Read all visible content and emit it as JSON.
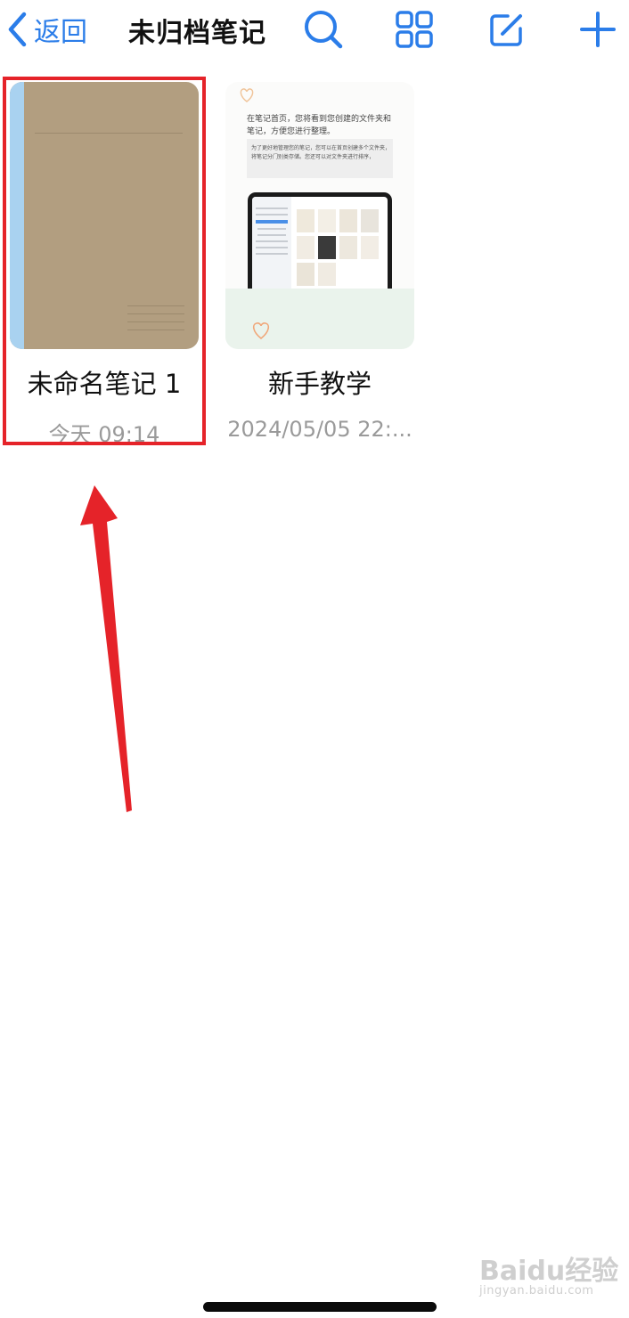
{
  "navbar": {
    "back_label": "返回",
    "title": "未归档笔记",
    "icons": [
      "search-icon",
      "grid-view-icon",
      "compose-icon",
      "add-icon"
    ],
    "accent": "#2b7de9"
  },
  "notes": [
    {
      "name": "未命名笔记 1",
      "date": "今天 09:14",
      "cover_color": "#b29e80",
      "spine_color": "#a9d2f0"
    },
    {
      "name": "新手教学",
      "date": "2024/05/05 22:..."
    }
  ],
  "tutorial_thumb": {
    "line1": "在笔记首页，您将看到您创建的文件夹和",
    "line2": "笔记，方便您进行整理。",
    "box_line1": "为了更好地管理您的笔记，您可以在首页创建多个文件夹，",
    "box_line2": "将笔记分门别类存储。您还可以对文件夹进行排序，"
  },
  "annotation": {
    "color": "#e52329"
  },
  "watermark": {
    "text": "Baidu经验",
    "sub": "jingyan.baidu.com"
  }
}
